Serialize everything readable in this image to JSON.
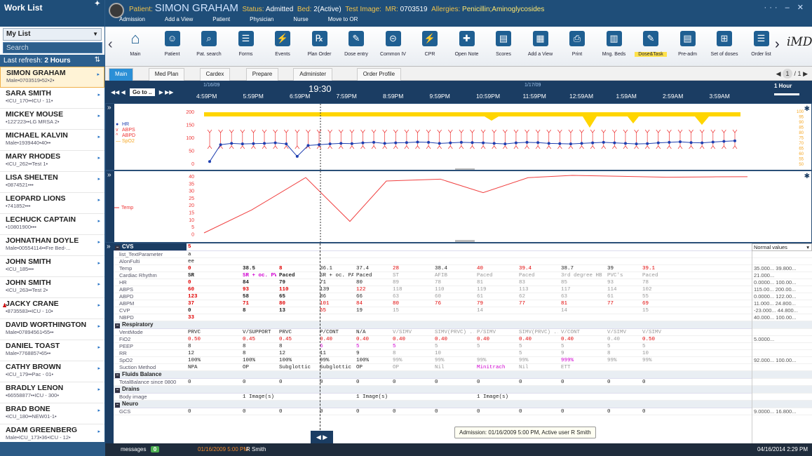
{
  "sidebar": {
    "title": "Work List",
    "list_label": "My List",
    "search_placeholder": "Search",
    "refresh_label": "Last refresh:",
    "refresh_value": "2 Hours",
    "patients": [
      {
        "name": "SIMON GRAHAM",
        "sub": "Male•0703519•52•2•",
        "selected": true
      },
      {
        "name": "SARA SMITH",
        "sub": "•ICU_170••ICU - 11•"
      },
      {
        "name": "MICKEY MOUSE",
        "sub": "•122'223••LG MRSA 2•"
      },
      {
        "name": "MICHAEL KALVIN",
        "sub": "Male•1939440•40••"
      },
      {
        "name": "MARY RHODES",
        "sub": "•ICU_262••Test 1•"
      },
      {
        "name": "LISA SHELTEN",
        "sub": "•0874521•••"
      },
      {
        "name": "LEOPARD LIONS",
        "sub": "•741852•••"
      },
      {
        "name": "LECHUCK CAPTAIN",
        "sub": "•10801900•••"
      },
      {
        "name": "JOHNATHAN DOYLE",
        "sub": "Male•00554114••Fre Bed-..."
      },
      {
        "name": "JOHN SMITH",
        "sub": "•ICU_185•••"
      },
      {
        "name": "JOHN SMITH",
        "sub": "•ICU_263••Test 2•"
      },
      {
        "name": "JACKY CRANE",
        "sub": "•8735583••ICU - 10•",
        "flag": true
      },
      {
        "name": "DAVID WORTHINGTON",
        "sub": "Male•07894561•55••"
      },
      {
        "name": "DANIEL TOAST",
        "sub": "Male•7768857•65••"
      },
      {
        "name": "CATHY BROWN",
        "sub": "•ICU_179••Pac - 01•"
      },
      {
        "name": "BRADLY LENON",
        "sub": "•66558877••ICU - 300•"
      },
      {
        "name": "BRAD BONE",
        "sub": "•ICU_180••NEW01-1•"
      },
      {
        "name": "ADAM GREENBERG",
        "sub": "Male•ICU_173•36•ICU - 12•"
      }
    ]
  },
  "header": {
    "patient_label": "Patient:",
    "patient_name": "SIMON GRAHAM",
    "status_label": "Status:",
    "status_value": "Admitted",
    "bed_label": "Bed:",
    "bed_value": "2(Active)",
    "test_label": "Test Image:",
    "mr_label": "MR:",
    "mr_value": "0703519",
    "allergies_label": "Allergies:",
    "allergies_value": "Penicillin;Aminoglycosides",
    "nav": [
      "Admission",
      "Add a View",
      "Patient",
      "Physician",
      "Nurse",
      "Move to OR"
    ]
  },
  "toolbar": {
    "items": [
      "Main",
      "Patient",
      "Pat. search",
      "Forms",
      "Events",
      "Plan Order",
      "Dose entry",
      "Common IV",
      "CPR",
      "Open Note",
      "Scores",
      "Add a View",
      "Print",
      "Mng. Beds",
      "Dose&Task",
      "Pre-adm",
      "Set of doses",
      "Order list"
    ],
    "brand": "iMDsoft"
  },
  "tabs": [
    "Main",
    "Med Plan",
    "Cardex",
    "Prepare",
    "Administer",
    "Order Profile"
  ],
  "pager": {
    "current": "1",
    "total": "/ 1"
  },
  "timebar": {
    "goto_label": "Go to ..",
    "current_time": "19:30",
    "date_left": "1/16/09",
    "date_right": "1/17/09",
    "times": [
      "4:59PM",
      "5:59PM",
      "6:59PM",
      "7:59PM",
      "8:59PM",
      "9:59PM",
      "10:59PM",
      "11:59PM",
      "12:59AM",
      "1:59AM",
      "2:59AM",
      "3:59AM"
    ],
    "interval": "1 Hour"
  },
  "vitals": {
    "legend": [
      "HR",
      "ABPS",
      "ABPD",
      "SpO2"
    ],
    "y_left": [
      "200",
      "150",
      "100",
      "50",
      "0"
    ],
    "y_right": [
      "100",
      "95",
      "90",
      "85",
      "80",
      "75",
      "70",
      "65",
      "60",
      "55",
      "50"
    ],
    "hr": [
      10,
      75,
      80,
      78,
      79,
      80,
      82,
      78,
      30,
      72,
      75,
      78,
      80,
      79,
      82,
      84,
      80,
      82,
      83,
      85,
      84,
      80,
      82,
      84,
      83,
      82,
      80,
      78,
      82,
      84,
      83,
      80,
      79,
      78,
      80,
      82,
      84,
      82,
      80,
      78,
      79,
      82,
      84,
      86,
      83,
      82,
      85,
      88,
      90
    ]
  },
  "temp": {
    "legend": "Temp",
    "y": [
      "40",
      "35",
      "30",
      "25",
      "20",
      "15",
      "10",
      "5",
      "0"
    ],
    "values": [
      16,
      38.5,
      8,
      36.1,
      37.4,
      28,
      38.4,
      40,
      39.4,
      38.7,
      39,
      39.1
    ]
  },
  "grid": {
    "norm_select": "Normal values",
    "rows": [
      {
        "label": "CVS",
        "cat": true,
        "cells": [
          "5"
        ]
      },
      {
        "label": "list_TextParameter",
        "cells": [
          "a"
        ]
      },
      {
        "label": "AlonFulti",
        "cells": [
          "ee"
        ]
      },
      {
        "label": "Temp",
        "cells": [
          "0",
          "38.5",
          "8",
          "36.1",
          "37.4",
          "28",
          "38.4",
          "40",
          "39.4",
          "38.7",
          "39",
          "39.1"
        ],
        "norm": "35.000... 39.800..."
      },
      {
        "label": "Cardiac Rhythm",
        "cells": [
          "SR",
          "SR + oc. PVC's",
          "Paced",
          "SR + oc. PAC's",
          "Paced",
          "ST",
          "AFIB",
          "Paced",
          "Paced",
          "3rd degree HB",
          "PVC's",
          "Paced"
        ],
        "norm": "21.000..."
      },
      {
        "label": "HR",
        "cells": [
          "0",
          "84",
          "79",
          "71",
          "80",
          "89",
          "78",
          "81",
          "83",
          "85",
          "93",
          "78"
        ],
        "norm": "0.0000... 100.00..."
      },
      {
        "label": "ABPS",
        "cells": [
          "60",
          "93",
          "110",
          "139",
          "122",
          "118",
          "110",
          "119",
          "113",
          "117",
          "114",
          "102"
        ],
        "norm": "115.00... 200.00..."
      },
      {
        "label": "ABPD",
        "cells": [
          "123",
          "58",
          "65",
          "86",
          "66",
          "63",
          "60",
          "61",
          "62",
          "63",
          "61",
          "55"
        ],
        "norm": "0.0000... 122.00..."
      },
      {
        "label": "ABPM",
        "cells": [
          "37",
          "71",
          "80",
          "101",
          "84",
          "80",
          "76",
          "79",
          "77",
          "81",
          "77",
          "69"
        ],
        "norm": "11.000... 24.800..."
      },
      {
        "label": "CVP",
        "cells": [
          "0",
          "8",
          "13",
          "55",
          "19",
          "15",
          "",
          "14",
          "",
          "14",
          "",
          "15"
        ],
        "norm": "-23.000... 44.800..."
      },
      {
        "label": "NBPD",
        "cells": [
          "33"
        ],
        "norm": "40.000... 100.00..."
      },
      {
        "label": "Respiratory",
        "cat": true,
        "cells": []
      },
      {
        "label": "VentMode",
        "cells": [
          "PRVC",
          "V/SUPPORT",
          "PRVC",
          "P/CONT",
          "N/A",
          "V/SIMV",
          "SIMV(PRVC) ...",
          "P/SIMV",
          "SIMV(PRVC) ...",
          "V/CONT",
          "V/SIMV",
          "V/SIMV"
        ]
      },
      {
        "label": "FiO2",
        "cells": [
          "0.50",
          "0.45",
          "0.45",
          "0.40",
          "0.40",
          "0.40",
          "0.40",
          "0.40",
          "0.40",
          "0.40",
          "0.40",
          "0.50"
        ],
        "norm": "5.0000..."
      },
      {
        "label": "PEEP",
        "cells": [
          "8",
          "8",
          "8",
          "6",
          "5",
          "5",
          "5",
          "5",
          "5",
          "5",
          "5",
          "5"
        ]
      },
      {
        "label": "RR",
        "cells": [
          "12",
          "8",
          "12",
          "11",
          "9",
          "8",
          "10",
          "",
          "5",
          "9",
          "8",
          "10"
        ]
      },
      {
        "label": "SpO2",
        "cells": [
          "100%",
          "100%",
          "100%",
          "99%",
          "100%",
          "99%",
          "99%",
          "99%",
          "99%",
          "999%",
          "99%",
          "99%"
        ],
        "norm": "92.000... 100.00..."
      },
      {
        "label": "Suction Method",
        "cells": [
          "NPA",
          "OP",
          "Subglottic",
          "Subglottic",
          "OP",
          "OP",
          "Nil",
          "Minitrach",
          "Nil",
          "ETT"
        ]
      },
      {
        "label": "Fluids Balance",
        "cat": true,
        "cells": []
      },
      {
        "label": "TotalBalance since 0800",
        "cells": [
          "0",
          "0",
          "0",
          "0",
          "0",
          "0",
          "0",
          "0",
          "0",
          "0",
          "0",
          "0"
        ]
      },
      {
        "label": "Drains",
        "cat": true,
        "cells": []
      },
      {
        "label": "Body image",
        "cells": [
          "",
          "1 Image(s)",
          "",
          "",
          "1 Image(s)",
          "",
          "",
          "1 Image(s)"
        ]
      },
      {
        "label": "Neuro",
        "cat": true,
        "cells": []
      },
      {
        "label": "GCS",
        "cells": [
          "0",
          "0",
          "0",
          "0",
          "0",
          "0",
          "0",
          "0",
          "0",
          "0",
          "0",
          "0"
        ],
        "norm": "9.0000... 16.800..."
      }
    ]
  },
  "tooltip": "Admission: 01/16/2009 5:00 PM, Active user R Smith",
  "bottombar": {
    "messages_label": "messages",
    "messages_count": "0",
    "date": "01/16/2009 5:00 PM",
    "user": "R Smith",
    "now": "04/16/2014 2:29 PM"
  },
  "colors": {
    "accent": "#1f4e79",
    "alert": "#e00000",
    "highlight": "#d000d0",
    "tab_active": "#2b8fd6"
  }
}
